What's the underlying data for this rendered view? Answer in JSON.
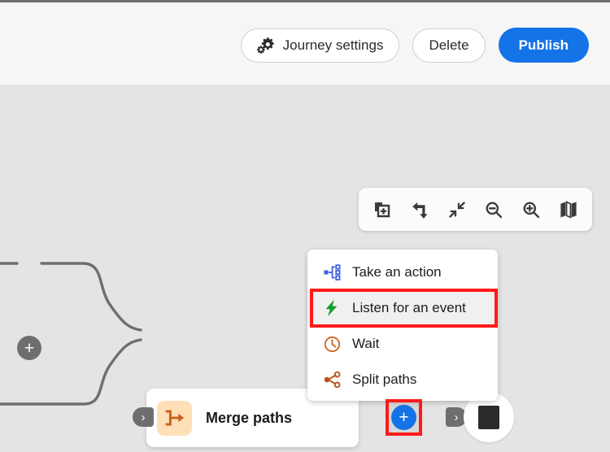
{
  "topbar": {
    "buttons": [
      {
        "label": "Journey settings",
        "icon": "gears-icon",
        "name": "journey-settings-button",
        "primary": false
      },
      {
        "label": "Delete",
        "icon": null,
        "name": "delete-button",
        "primary": false
      },
      {
        "label": "Publish",
        "icon": null,
        "name": "publish-button",
        "primary": true
      }
    ]
  },
  "canvas_toolbar": {
    "buttons": [
      {
        "name": "add-copy-icon",
        "title": "Add copy"
      },
      {
        "name": "undo-arrow-icon",
        "title": "Undo"
      },
      {
        "name": "collapse-icon",
        "title": "Fit to view"
      },
      {
        "name": "zoom-out-icon",
        "title": "Zoom out"
      },
      {
        "name": "zoom-in-icon",
        "title": "Zoom in"
      },
      {
        "name": "map-icon",
        "title": "Minimap"
      }
    ]
  },
  "menu": {
    "items": [
      {
        "label": "Take an action",
        "icon": "action-node-icon",
        "color": "#3b5ce0",
        "highlighted": false
      },
      {
        "label": "Listen for an event",
        "icon": "lightning-bolt-icon",
        "color": "#0f9d2e",
        "highlighted": true
      },
      {
        "label": "Wait",
        "icon": "clock-icon",
        "color": "#c8621a",
        "highlighted": false
      },
      {
        "label": "Split paths",
        "icon": "split-paths-icon",
        "color": "#b9521a",
        "highlighted": false
      }
    ]
  },
  "flow": {
    "merge_node": {
      "label": "Merge paths",
      "icon": "merge-paths-icon",
      "icon_bg": "#ffdfb8",
      "icon_color": "#c8621a"
    },
    "add_step_plus": {
      "label": "+",
      "name": "add-step-plus-button",
      "color": "#1473e6"
    },
    "branch_plus": {
      "label": "+",
      "name": "branch-plus-button",
      "color": "#6e6e6e"
    },
    "end_node": {
      "name": "journey-end-node"
    }
  },
  "colors": {
    "accent_blue": "#1473e6",
    "highlight_red": "#ff1a1a",
    "canvas_bg": "#e4e4e4",
    "topbar_bg": "#f6f6f6",
    "connector": "#6e6e6e"
  }
}
